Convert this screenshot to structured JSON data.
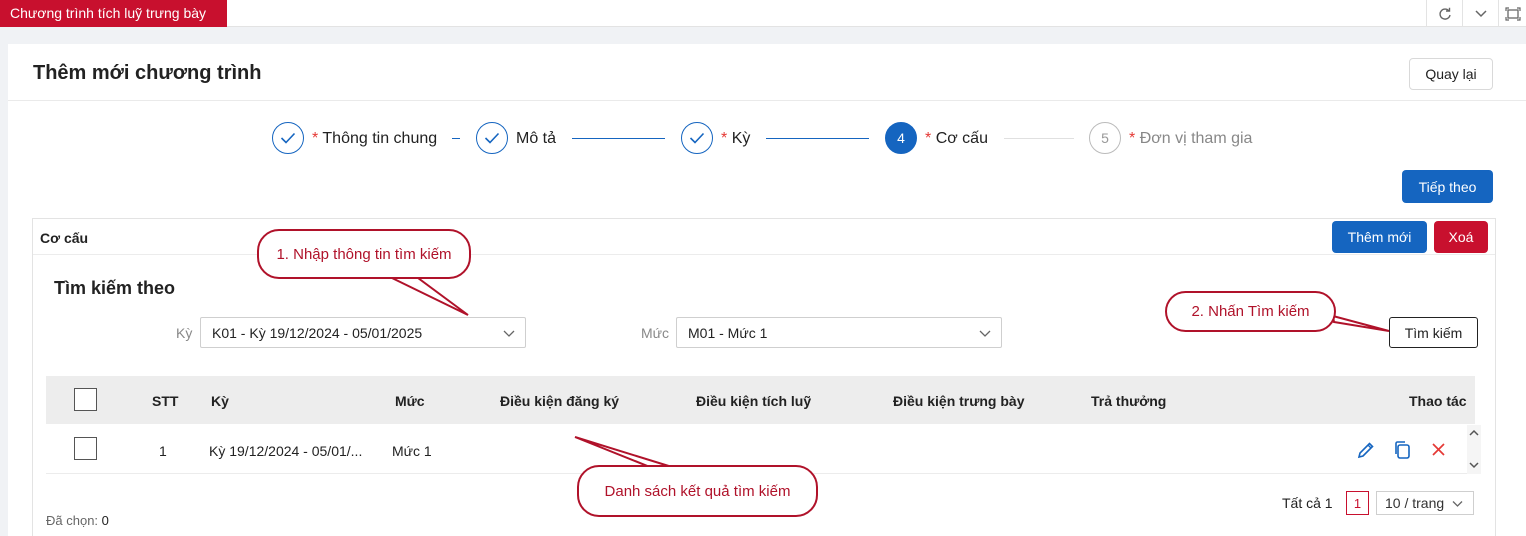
{
  "tabs": {
    "active": "Chương trình tích luỹ trưng bày"
  },
  "header": {
    "title": "Thêm mới chương trình",
    "back_label": "Quay lại"
  },
  "steps": [
    {
      "index": "1",
      "label": "Thông tin chung",
      "required": "*",
      "status": "done"
    },
    {
      "index": "2",
      "label": "Mô tả",
      "required": "",
      "status": "done"
    },
    {
      "index": "3",
      "label": "Kỳ",
      "required": "*",
      "status": "done"
    },
    {
      "index": "4",
      "label": "Cơ cấu",
      "required": "*",
      "status": "active"
    },
    {
      "index": "5",
      "label": "Đơn vị tham gia",
      "required": "*",
      "status": "wait"
    }
  ],
  "next_label": "Tiếp theo",
  "section": {
    "title": "Cơ cấu",
    "add_label": "Thêm mới",
    "delete_label": "Xoá"
  },
  "search": {
    "title": "Tìm kiếm theo",
    "ky_label": "Kỳ",
    "ky_value": "K01 - Kỳ 19/12/2024 - 05/01/2025",
    "muc_label": "Mức",
    "muc_value": "M01 - Mức 1",
    "button_label": "Tìm kiếm"
  },
  "table": {
    "columns": [
      "STT",
      "Kỳ",
      "Mức",
      "Điều kiện đăng ký",
      "Điều kiện tích luỹ",
      "Điều kiện trưng bày",
      "Trả thưởng",
      "Thao tác"
    ],
    "rows": [
      {
        "stt": "1",
        "ky": "Kỳ 19/12/2024 - 05/01/...",
        "muc": "Mức 1",
        "dk_dang_ky": "",
        "dk_tich_luy": "",
        "dk_trung_bay": "",
        "tra_thuong": ""
      }
    ]
  },
  "footer": {
    "selected_label": "Đã chọn:",
    "selected_count": "0",
    "total_label": "Tất cả 1",
    "current_page": "1",
    "page_size": "10 / trang"
  },
  "callouts": {
    "step1": "1. Nhập thông tin tìm kiếm",
    "step2": "2. Nhấn Tìm kiếm",
    "result": "Danh sách kết quả tìm kiếm"
  },
  "colors": {
    "brand_red": "#c8102e",
    "primary_blue": "#1565c0",
    "callout_red": "#b0122a"
  }
}
